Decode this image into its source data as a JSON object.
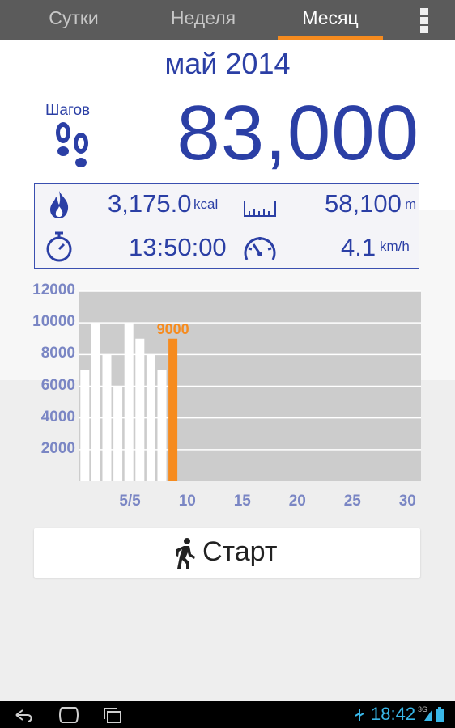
{
  "tabs": [
    {
      "label": "Сутки",
      "active": false
    },
    {
      "label": "Неделя",
      "active": false
    },
    {
      "label": "Месяц",
      "active": true
    }
  ],
  "month_title": "май 2014",
  "steps": {
    "label": "Шагов",
    "value": "83,000"
  },
  "stats": {
    "calories": {
      "value": "3,175.0",
      "unit": "kcal",
      "icon": "flame-icon"
    },
    "distance": {
      "value": "58,100",
      "unit": "m",
      "icon": "ruler-icon"
    },
    "duration": {
      "value": "13:50:00",
      "icon": "stopwatch-icon"
    },
    "speed": {
      "value": "4.1",
      "unit": "km/h",
      "icon": "speedometer-icon"
    }
  },
  "chart_data": {
    "type": "bar",
    "y_ticks": [
      "12000",
      "10000",
      "8000",
      "6000",
      "4000",
      "2000"
    ],
    "x_ticks": [
      "5/5",
      "10",
      "15",
      "20",
      "25",
      "30"
    ],
    "ylim": [
      0,
      12000
    ],
    "days": [
      1,
      2,
      3,
      4,
      5,
      6,
      7,
      8,
      9
    ],
    "values": [
      7000,
      10000,
      8000,
      6000,
      10000,
      9000,
      8000,
      7000,
      9000
    ],
    "highlight_day": 9,
    "highlight_label": "9000",
    "highlight_color": "#f68b1e",
    "bar_color": "#ffffff",
    "plot_bg": "#cccccc"
  },
  "start_button": {
    "label": "Старт",
    "icon": "walking-person-icon"
  },
  "system_bar": {
    "time": "18:42",
    "network": "3G"
  }
}
